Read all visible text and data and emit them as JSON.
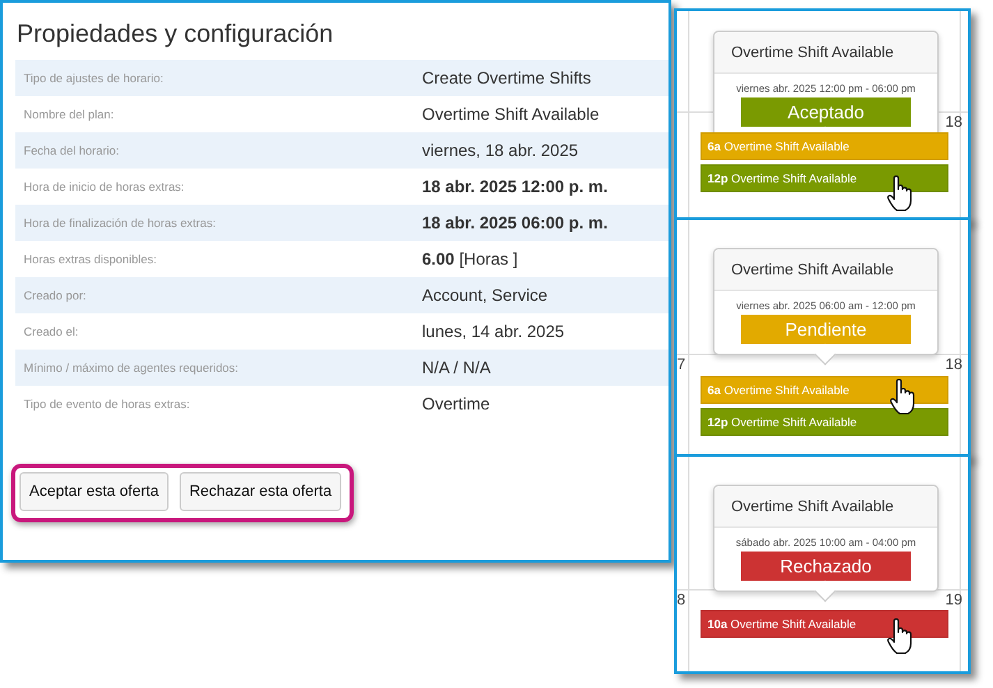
{
  "properties": {
    "title": "Propiedades y configuración",
    "rows": [
      {
        "label": "Tipo de ajustes de horario:",
        "value": "Create Overtime Shifts",
        "bold": false
      },
      {
        "label": "Nombre del plan:",
        "value": "Overtime Shift Available",
        "bold": false
      },
      {
        "label": "Fecha del horario:",
        "value": "viernes, 18 abr. 2025",
        "bold": false
      },
      {
        "label": "Hora de inicio de horas extras:",
        "value": "18 abr. 2025 12:00 p. m.",
        "bold": true
      },
      {
        "label": "Hora de finalización de horas extras:",
        "value": "18 abr. 2025 06:00 p. m.",
        "bold": true
      },
      {
        "label": "Horas extras disponibles:",
        "value": "**6.00**  [Horas ]",
        "bold": false
      },
      {
        "label": "Creado por:",
        "value": "Account, Service",
        "bold": false
      },
      {
        "label": "Creado el:",
        "value": "lunes, 14 abr. 2025",
        "bold": false
      },
      {
        "label": "Mínimo / máximo de agentes requeridos:",
        "value": "N/A  / N/A",
        "bold": false
      },
      {
        "label": "Tipo de evento de horas extras:",
        "value": "Overtime",
        "bold": false
      }
    ],
    "buttons": [
      "Aceptar esta oferta",
      "Rechazar esta oferta"
    ]
  },
  "calendar_views": [
    {
      "right_day": "18",
      "popup": {
        "title": "Overtime Shift Available",
        "time": "viernes abr. 2025 12:00 pm - 06:00 pm",
        "status": "Aceptado",
        "color": "#7a9a01"
      },
      "events": [
        {
          "time": "6a",
          "title": "Overtime Shift Available",
          "color": "#e2aa00"
        },
        {
          "time": "12p",
          "title": "Overtime Shift Available",
          "color": "#7a9a01"
        }
      ]
    },
    {
      "left_day": "7",
      "right_day": "18",
      "popup": {
        "title": "Overtime Shift Available",
        "time": "viernes abr. 2025 06:00 am - 12:00 pm",
        "status": "Pendiente",
        "color": "#e2aa00"
      },
      "events": [
        {
          "time": "6a",
          "title": "Overtime Shift Available",
          "color": "#e2aa00"
        },
        {
          "time": "12p",
          "title": "Overtime Shift Available",
          "color": "#7a9a01"
        }
      ]
    },
    {
      "left_day": "8",
      "right_day": "19",
      "popup": {
        "title": "Overtime Shift Available",
        "time": "sábado abr. 2025 10:00 am - 04:00 pm",
        "status": "Rechazado",
        "color": "#cc3333"
      },
      "events": [
        {
          "time": "10a",
          "title": "Overtime Shift Available",
          "color": "#cc3333"
        }
      ]
    }
  ]
}
